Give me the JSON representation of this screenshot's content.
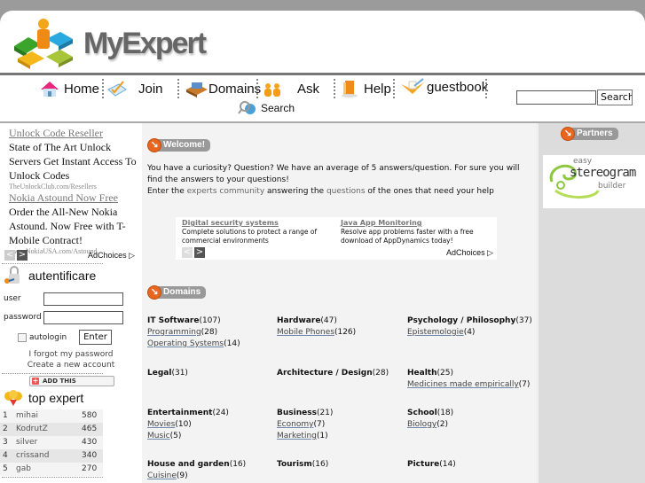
{
  "brand": {
    "name": "MyExpert"
  },
  "nav": {
    "items": [
      {
        "label": "Home",
        "icon": "house-icon"
      },
      {
        "label": "Join",
        "icon": "checklist-pencil-icon"
      },
      {
        "label": "Domains",
        "icon": "card-box-icon"
      },
      {
        "label": "Ask",
        "icon": "people-icon"
      },
      {
        "label": "Help",
        "icon": "book-icon"
      },
      {
        "label": "guestbook",
        "icon": "notebook-pencil-icon"
      }
    ],
    "search_link": {
      "label": "Search",
      "icon": "magnifier-globe-icon"
    },
    "search_input": {
      "value": "",
      "placeholder": ""
    },
    "search_button": "Search"
  },
  "left_ad": {
    "ads": [
      {
        "title": "Unlock Code Reseller",
        "body": "State of The Art Unlock Servers Get Instant Access To Unlock Codes",
        "url": "TheUnlockClub.com/Resellers"
      },
      {
        "title": "Nokia Astound Now Free",
        "body": "Order the All-New Nokia Astound. Now Free with T-Mobile Contract!",
        "url": "www.NokiaUSA.com/Astound"
      }
    ],
    "prev": "<",
    "next": ">",
    "adchoices": "AdChoices ▷"
  },
  "auth": {
    "title": "autentificare",
    "user_label": "user",
    "password_label": "password",
    "user_value": "",
    "password_value": "",
    "autologin_label": "autologin",
    "autologin_checked": false,
    "enter_button": "Enter",
    "forgot_link": "I forgot my password",
    "create_link": "Create a new account"
  },
  "addthis": {
    "label": "ADD THIS"
  },
  "top_expert": {
    "title": "top expert",
    "rows": [
      {
        "rank": "1",
        "name": "mihai",
        "points": "580"
      },
      {
        "rank": "2",
        "name": "KodrutZ",
        "points": "465"
      },
      {
        "rank": "3",
        "name": "silver",
        "points": "430"
      },
      {
        "rank": "4",
        "name": "crissand",
        "points": "340"
      },
      {
        "rank": "5",
        "name": "gab",
        "points": "270"
      }
    ]
  },
  "welcome": {
    "badge": "Welcome!",
    "line1": "You have a curiosity? Question? We have an average of 5 answers/question. For sure you will find the answers to your questions!",
    "line2_pre": "Enter the ",
    "line2_link1": "experts community",
    "line2_mid": " answering the ",
    "line2_link2": "questions",
    "line2_post": " of the ones that need your help"
  },
  "main_ad": {
    "ads": [
      {
        "title": "Digital security systems",
        "body": "Complete solutions to protect a range of commercial environments"
      },
      {
        "title": "Java App Monitoring",
        "body": "Resolve app problems faster with a free download of AppDynamics today!"
      }
    ],
    "prev": "<",
    "next": ">",
    "adchoices": "AdChoices ▷"
  },
  "domains": {
    "badge": "Domains",
    "items": [
      {
        "title": "IT Software",
        "count": "(107)",
        "subs": [
          {
            "name": "Programming",
            "count": "(28)"
          },
          {
            "name": "Operating Systems",
            "count": "(14)"
          }
        ]
      },
      {
        "title": "Hardware",
        "count": "(47)",
        "subs": [
          {
            "name": "Mobile Phones",
            "count": "(126)"
          }
        ]
      },
      {
        "title": "Psychology / Philosophy",
        "count": "(37)",
        "subs": [
          {
            "name": "Epistemologie",
            "count": "(4)"
          }
        ]
      },
      {
        "title": "Legal",
        "count": "(31)",
        "subs": []
      },
      {
        "title": "Architecture / Design",
        "count": "(28)",
        "subs": []
      },
      {
        "title": "Health",
        "count": "(25)",
        "subs": [
          {
            "name": "Medicines made empirically",
            "count": "(7)"
          }
        ]
      },
      {
        "title": "Entertainment",
        "count": "(24)",
        "subs": [
          {
            "name": "Movies",
            "count": "(10)"
          },
          {
            "name": "Music",
            "count": "(5)"
          }
        ]
      },
      {
        "title": "Business",
        "count": "(21)",
        "subs": [
          {
            "name": "Economy",
            "count": "(7)"
          },
          {
            "name": "Marketing",
            "count": "(1)"
          }
        ]
      },
      {
        "title": "School",
        "count": "(18)",
        "subs": [
          {
            "name": "Biology",
            "count": "(2)"
          }
        ]
      },
      {
        "title": "House and garden",
        "count": "(16)",
        "subs": [
          {
            "name": "Cuisine",
            "count": "(9)"
          }
        ]
      },
      {
        "title": "Tourism",
        "count": "(16)",
        "subs": []
      },
      {
        "title": "Picture",
        "count": "(14)",
        "subs": []
      }
    ]
  },
  "partners": {
    "badge": "Partners",
    "banner": {
      "line1": "easy",
      "line2": "stereogram",
      "line3": "builder"
    }
  },
  "colors": {
    "accent_orange": "#e8661f",
    "badge_gray": "#999999",
    "main_bg": "#f3f3f3",
    "right_bg": "#dcdcdc",
    "partner_green": "#8dc63f"
  }
}
